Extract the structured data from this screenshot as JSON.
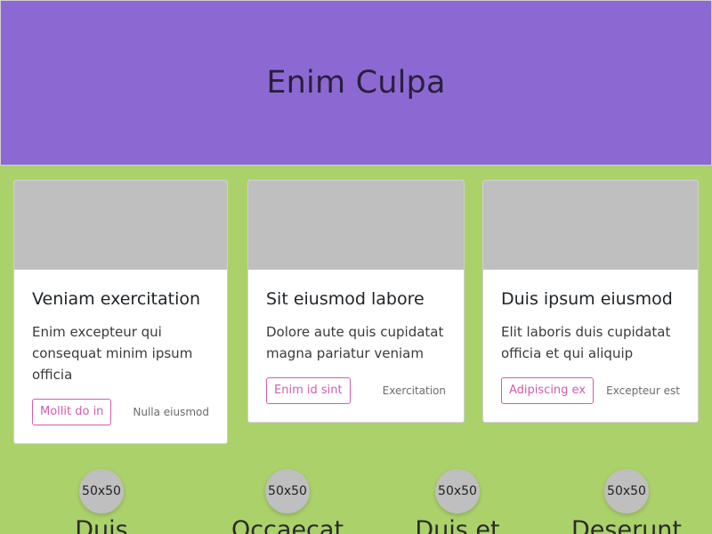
{
  "hero": {
    "title": "Enim Culpa",
    "background": "#8c69d2"
  },
  "cards": [
    {
      "title": "Veniam exercitation",
      "text": "Enim excepteur qui consequat minim ipsum officia",
      "button": "Mollit do in",
      "meta": "Nulla eiusmod"
    },
    {
      "title": "Sit eiusmod labore",
      "text": "Dolore aute quis cupidatat magna pariatur veniam",
      "button": "Enim id sint",
      "meta": "Exercitation"
    },
    {
      "title": "Duis ipsum eiusmod",
      "text": "Elit laboris duis cupidatat officia et qui aliquip",
      "button": "Adipiscing ex",
      "meta": "Excepteur est"
    }
  ],
  "features": [
    {
      "avatar": "50x50",
      "title": "Duis"
    },
    {
      "avatar": "50x50",
      "title": "Occaecat"
    },
    {
      "avatar": "50x50",
      "title": "Duis et"
    },
    {
      "avatar": "50x50",
      "title": "Deserunt"
    }
  ],
  "colors": {
    "page_background": "#abd16b",
    "accent": "#d05db0",
    "placeholder": "#bfbfbf"
  }
}
